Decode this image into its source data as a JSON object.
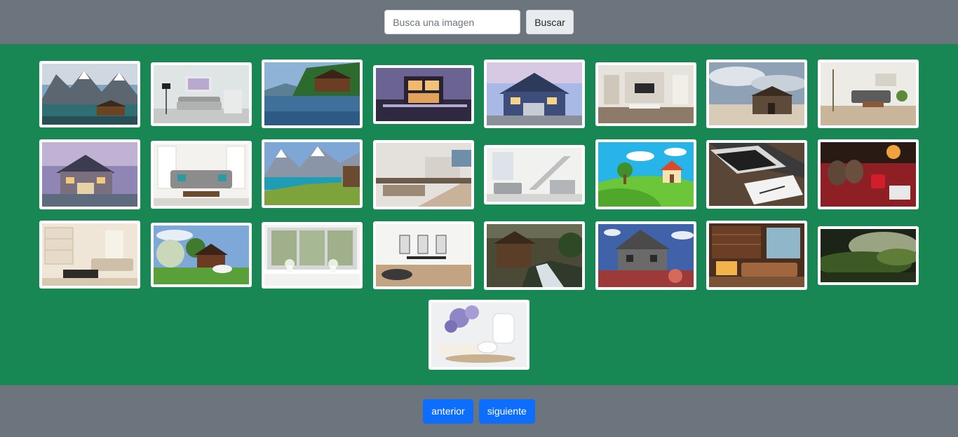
{
  "search": {
    "placeholder": "Busca una imagen",
    "value": "",
    "button_label": "Buscar"
  },
  "pagination": {
    "prev_label": "anterior",
    "next_label": "siguiente"
  },
  "colors": {
    "header_bg": "#6c757d",
    "gallery_bg": "#198754",
    "primary_button": "#0d6efd"
  },
  "images": [
    {
      "subject": "mountain lake with wooden boathouse"
    },
    {
      "subject": "bright living room with grey sofa"
    },
    {
      "subject": "wooden boathouse on a calm lake"
    },
    {
      "subject": "modern house at dusk"
    },
    {
      "subject": "suburban house at sunset"
    },
    {
      "subject": "modern living room with tv wall"
    },
    {
      "subject": "old wooden barn under cloudy sky"
    },
    {
      "subject": "living room with sofa and plants"
    },
    {
      "subject": "two-story house at dusk"
    },
    {
      "subject": "white living room with grey sofa"
    },
    {
      "subject": "turquoise alpine lake and mountains"
    },
    {
      "subject": "modern white kitchen"
    },
    {
      "subject": "white staircase interior"
    },
    {
      "subject": "cartoon house on a green hill"
    },
    {
      "subject": "laptop and notebook on desk"
    },
    {
      "subject": "cozy socks and red mug by fireplace"
    },
    {
      "subject": "cream living room with shelves"
    },
    {
      "subject": "house with blooming garden"
    },
    {
      "subject": "window with flowers on sill"
    },
    {
      "subject": "bright dining room"
    },
    {
      "subject": "old mill by a creek in forest"
    },
    {
      "subject": "old stone house under blue sky"
    },
    {
      "subject": "library room with leather sofas"
    },
    {
      "subject": "misty green valley"
    },
    {
      "subject": "lilac flowers with book and tea cup"
    }
  ]
}
